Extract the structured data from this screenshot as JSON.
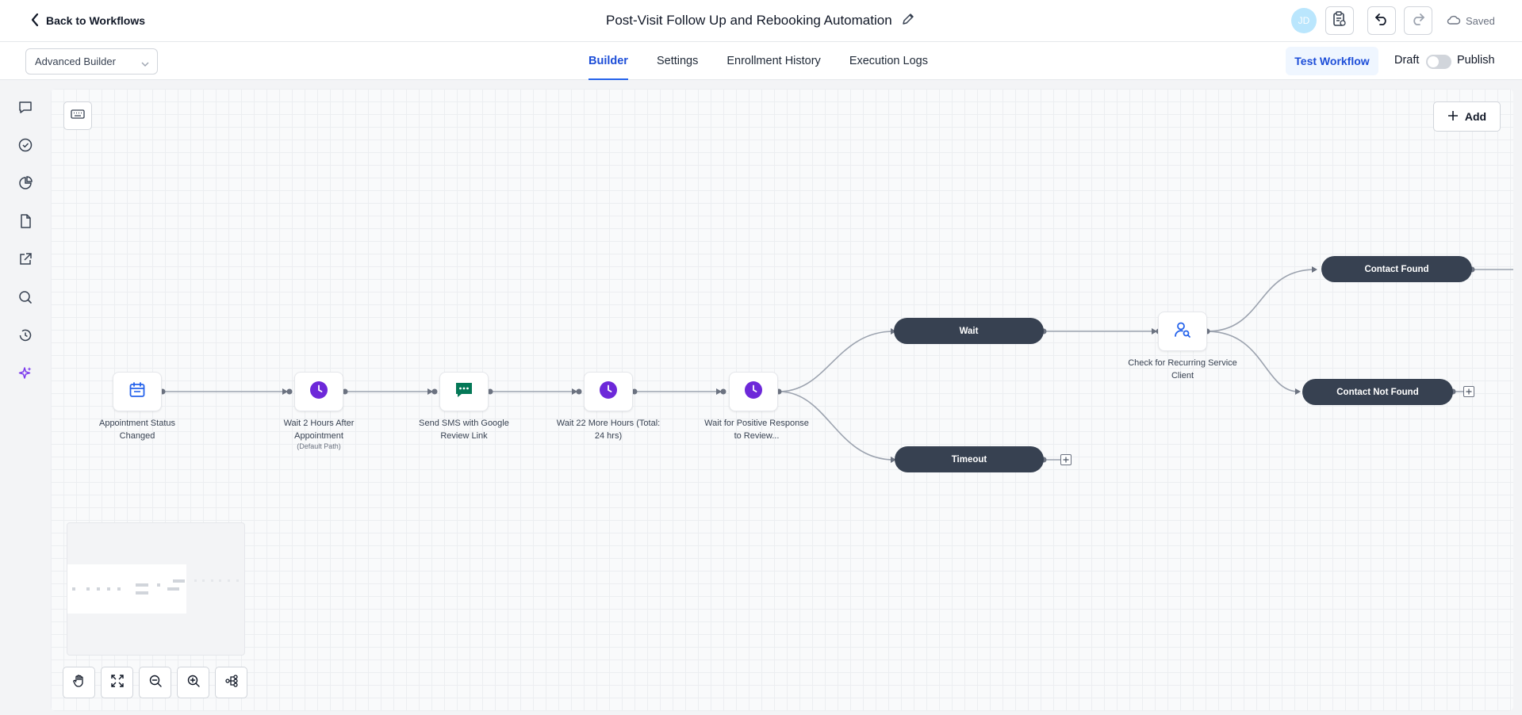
{
  "header": {
    "back_label": "Back to Workflows",
    "title": "Post-Visit Follow Up and Rebooking Automation",
    "avatar_initials": "JD",
    "saved_label": "Saved"
  },
  "subnav": {
    "builder_mode": "Advanced Builder",
    "tabs": [
      {
        "label": "Builder",
        "active": true
      },
      {
        "label": "Settings",
        "active": false
      },
      {
        "label": "Enrollment History",
        "active": false
      },
      {
        "label": "Execution Logs",
        "active": false
      }
    ],
    "test_workflow_label": "Test Workflow",
    "draft_label": "Draft",
    "publish_label": "Publish"
  },
  "sidebar": {
    "icons": [
      "chat-icon",
      "check-circle-icon",
      "pie-chart-icon",
      "file-icon",
      "external-link-icon",
      "search-icon",
      "history-icon",
      "sparkles-icon"
    ]
  },
  "canvas": {
    "add_label": "Add",
    "nodes": [
      {
        "id": "trigger",
        "label": "Appointment Status Changed",
        "icon": "calendar-icon"
      },
      {
        "id": "wait1",
        "label": "Wait 2 Hours After Appointment",
        "sub": "(Default Path)",
        "icon": "clock-icon"
      },
      {
        "id": "sms",
        "label": "Send SMS with Google Review Link",
        "icon": "message-icon"
      },
      {
        "id": "wait2",
        "label": "Wait 22 More Hours (Total: 24 hrs)",
        "icon": "clock-icon"
      },
      {
        "id": "wait3",
        "label": "Wait for Positive Response to Review...",
        "icon": "clock-icon"
      },
      {
        "id": "check",
        "label": "Check for Recurring Service Client",
        "icon": "user-search-icon"
      }
    ],
    "branches": {
      "wait": "Wait",
      "timeout": "Timeout",
      "contact_found": "Contact Found",
      "contact_not_found": "Contact Not Found"
    }
  },
  "colors": {
    "accent": "#2563eb",
    "wait_icon": "#6d28d9",
    "sms_icon": "#047857",
    "pill_bg": "#374151"
  }
}
